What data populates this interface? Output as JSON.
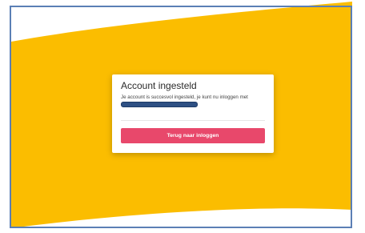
{
  "colors": {
    "background": "#ffffff",
    "accent_yellow": "#fbbd00",
    "button": "#e8486b",
    "frame_border": "#5b7fb5",
    "redaction": "#2e5083"
  },
  "card": {
    "title": "Account ingesteld",
    "message": "Je account is succesvol ingesteld, je kunt nu inloggen met",
    "button_label": "Terug naar inloggen"
  }
}
